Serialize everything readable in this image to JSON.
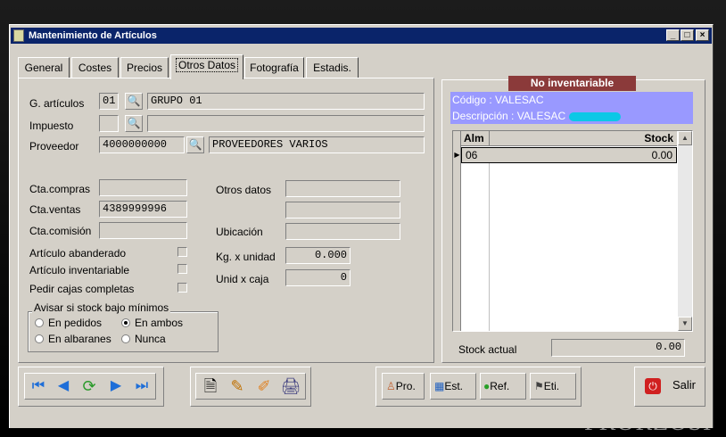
{
  "window": {
    "title": "Mantenimiento de Artículos",
    "min": "_",
    "max": "□",
    "close": "×"
  },
  "tabs": [
    "General",
    "Costes",
    "Precios",
    "Otros Datos",
    "Fotografía",
    "Estadis."
  ],
  "form": {
    "grupo": {
      "label": "G. artículos",
      "code": "01",
      "desc": "GRUPO 01"
    },
    "impuesto": {
      "label": "Impuesto",
      "code": "",
      "desc": ""
    },
    "proveedor": {
      "label": "Proveedor",
      "code": "4000000000",
      "desc": "PROVEEDORES VARIOS"
    },
    "cta_compras": {
      "label": "Cta.compras",
      "value": ""
    },
    "cta_ventas": {
      "label": "Cta.ventas",
      "value": "4389999996"
    },
    "cta_comision": {
      "label": "Cta.comisión",
      "value": ""
    },
    "otros_datos": {
      "label": "Otros datos"
    },
    "ubicacion": {
      "label": "Ubicación",
      "value": ""
    },
    "kg_unidad": {
      "label": "Kg. x unidad",
      "value": "0.000"
    },
    "unid_caja": {
      "label": "Unid x caja",
      "value": "0"
    },
    "abanderado": {
      "label": "Artículo abanderado"
    },
    "inventariable": {
      "label": "Artículo inventariable"
    },
    "cajas_completas": {
      "label": "Pedir cajas completas"
    },
    "aviso": {
      "legend": "Avisar si stock bajo mínimos",
      "opt1": "En pedidos",
      "opt2": "En ambos",
      "opt3": "En albaranes",
      "opt4": "Nunca"
    }
  },
  "stock": {
    "banner": "No inventariable",
    "codigo": "Código : VALESAC",
    "descripcion": "Descripción : VALESAC",
    "col_alm": "Alm",
    "col_stock": "Stock",
    "rows": [
      {
        "alm": "06",
        "stock": "0.00"
      }
    ],
    "actual_label": "Stock actual",
    "actual_value": "0.00"
  },
  "toolbar": {
    "pro": "Pro.",
    "est": "Est.",
    "ref": "Ref.",
    "eti": "Eti.",
    "salir": "Salir"
  },
  "background_text": "PRORZOSI",
  "colors": {
    "title_bar": "#0a246a",
    "banner": "#8b3a3a",
    "info_bar": "#9999ff",
    "grid_selected": "#d4d0c8",
    "face": "#d4d0c8"
  }
}
